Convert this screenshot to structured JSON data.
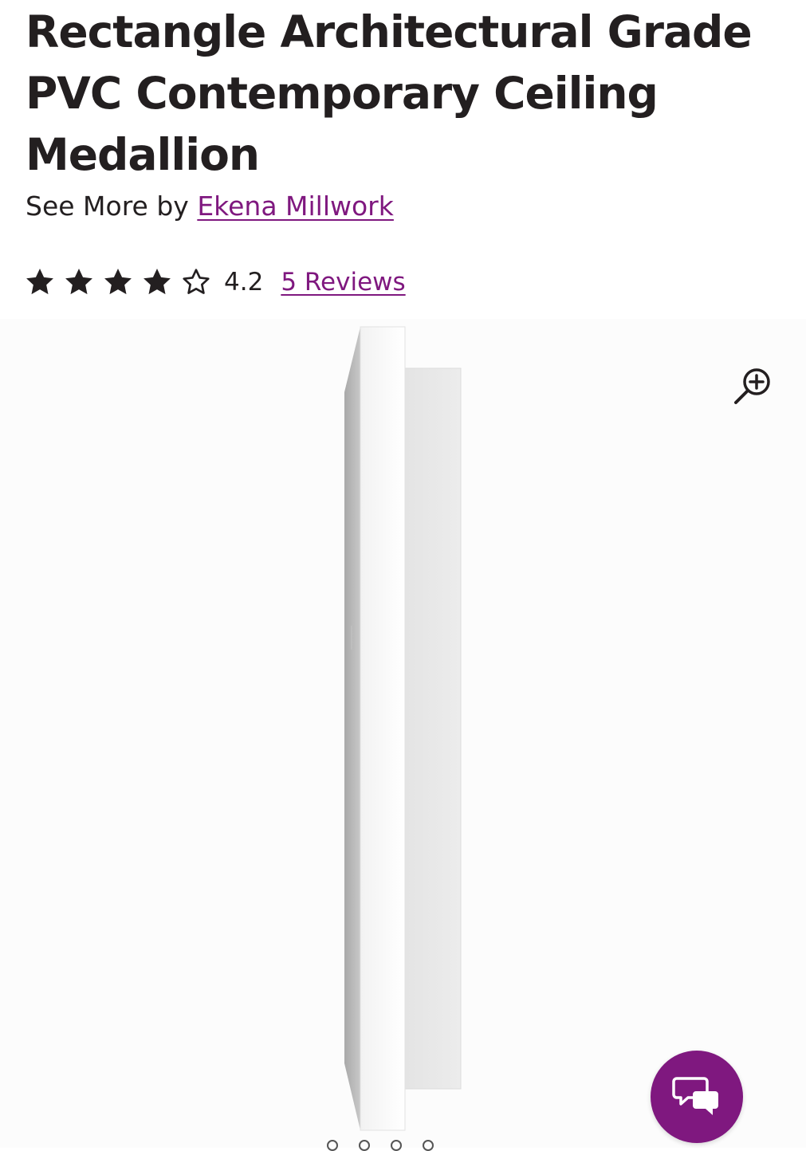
{
  "product": {
    "title": "Rectangle Architectural Grade PVC Contemporary Ceiling Medallion",
    "see_more_prefix": "See More by ",
    "brand": "Ekena Millwork"
  },
  "rating": {
    "value": "4.2",
    "stars_filled": 4,
    "stars_total": 5,
    "reviews_label": "5 Reviews"
  },
  "gallery": {
    "zoom_icon": "zoom-in-icon",
    "image_count": 4,
    "active_index": 0
  },
  "chat": {
    "icon": "chat-bubbles-icon"
  },
  "colors": {
    "accent": "#7f187f",
    "text": "#231f20",
    "star": "#231f20"
  }
}
